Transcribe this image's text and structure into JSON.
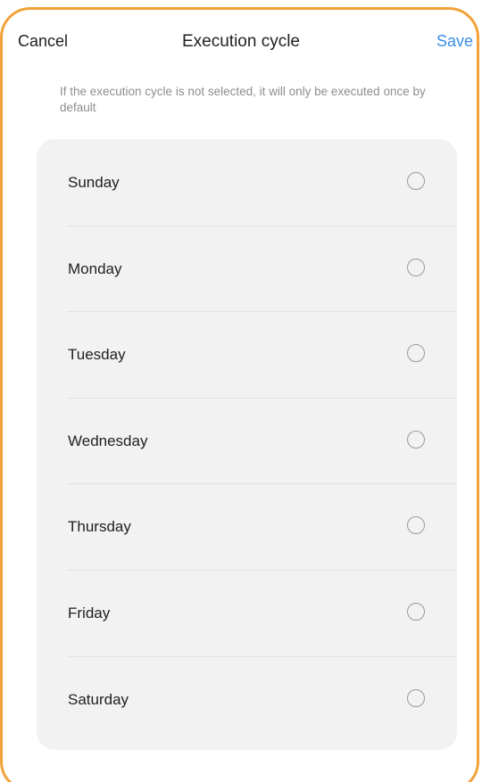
{
  "header": {
    "cancel_label": "Cancel",
    "title": "Execution cycle",
    "save_label": "Save"
  },
  "hint": "If the execution cycle is not selected, it will only be executed once by default",
  "days": [
    {
      "label": "Sunday",
      "selected": false
    },
    {
      "label": "Monday",
      "selected": false
    },
    {
      "label": "Tuesday",
      "selected": false
    },
    {
      "label": "Wednesday",
      "selected": false
    },
    {
      "label": "Thursday",
      "selected": false
    },
    {
      "label": "Friday",
      "selected": false
    },
    {
      "label": "Saturday",
      "selected": false
    }
  ],
  "colors": {
    "accent": "#3a8ee6",
    "frame_border": "#f2a23a",
    "card_background": "#f2f2f2",
    "hint_text": "#8e8e8e"
  }
}
